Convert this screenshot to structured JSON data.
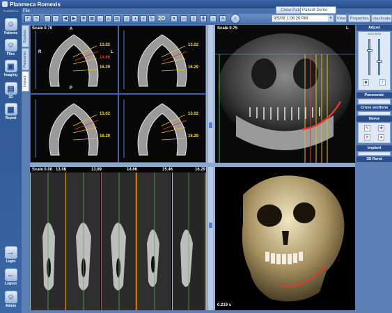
{
  "window": {
    "title": "Planmeca Romexis",
    "menu": "File"
  },
  "brand": "PLANMECA",
  "sidebar": {
    "items": [
      {
        "label": "Patients",
        "icon": "patients-icon"
      },
      {
        "label": "Files",
        "icon": "files-icon"
      },
      {
        "label": "Imaging",
        "icon": "imaging-icon"
      },
      {
        "label": "3D",
        "icon": "3d-icon"
      },
      {
        "label": "Report",
        "icon": "report-icon"
      },
      {
        "label": "Login",
        "icon": "login-icon"
      },
      {
        "label": "Logout",
        "icon": "logout-icon"
      },
      {
        "label": "Admin",
        "icon": "admin-icon"
      }
    ]
  },
  "toolbar": {
    "label_2d": "2D",
    "date_value": "9/5/08 1:06:26 PM",
    "close_patient": "Close Patient",
    "patient_name": "Patient Demo",
    "view": "View",
    "properties": "Properties",
    "inactivate": "Inactivate"
  },
  "tabs": [
    "Explorer",
    "Panoramic",
    "Implant"
  ],
  "viewports": {
    "axial": {
      "scale": "Scale 0.70",
      "orient": [
        "A",
        "R",
        "L",
        "P"
      ],
      "measures": [
        "13.02",
        "14.66",
        "16.29"
      ]
    },
    "pano": {
      "scale": "Scale 0.75",
      "L": "L"
    },
    "cross": {
      "scale": "Scale 0.00",
      "positions": [
        "13.08",
        "13.89",
        "14.66",
        "15.46",
        "16.29"
      ]
    },
    "render3d": {
      "time": "0.219 s"
    }
  },
  "right_panel": {
    "adjust": "Adjust",
    "range": "2372 3076",
    "panoramic": "Panoramic",
    "cross_sections": "Cross sections",
    "nerve": "Nerve",
    "implant": "Implant",
    "render_3d": "3D Rend"
  }
}
